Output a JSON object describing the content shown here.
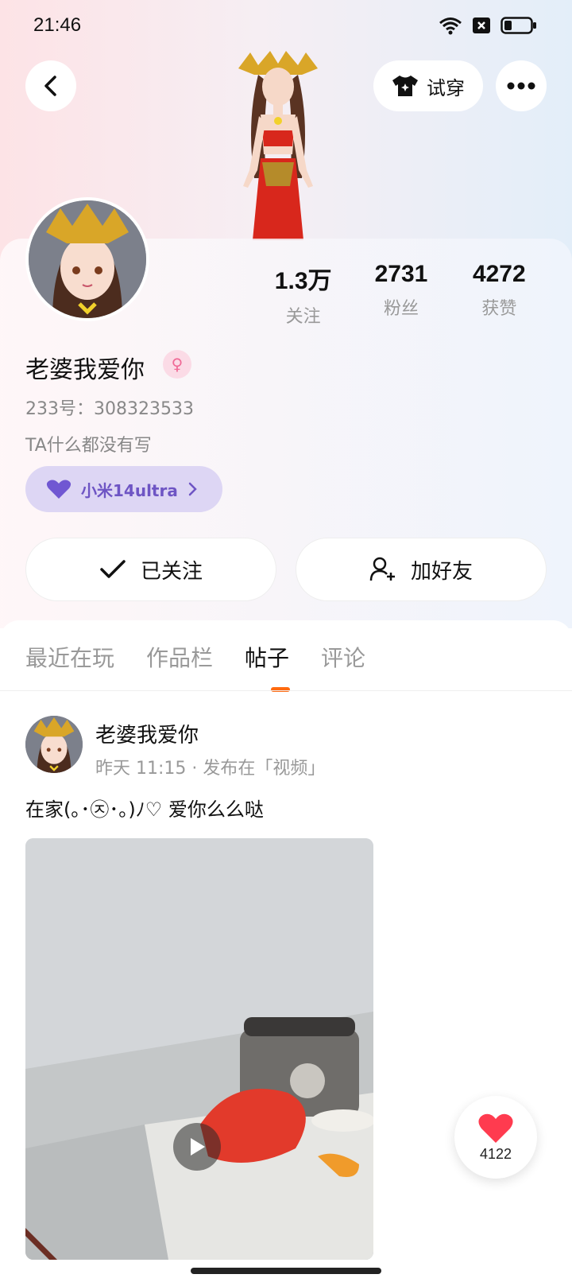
{
  "status_bar": {
    "time": "21:46"
  },
  "header": {
    "try_on_label": "试穿"
  },
  "profile": {
    "username": "老婆我爱你",
    "id_line": "233号：308323533",
    "bio": "TA什么都没有写",
    "device_tag": "小米14ultra",
    "stats": [
      {
        "value": "1.3万",
        "label": "关注"
      },
      {
        "value": "2731",
        "label": "粉丝"
      },
      {
        "value": "4272",
        "label": "获赞"
      }
    ],
    "followed_label": "已关注",
    "add_friend_label": "加好友"
  },
  "tabs": [
    {
      "label": "最近在玩"
    },
    {
      "label": "作品栏"
    },
    {
      "label": "帖子"
    },
    {
      "label": "评论"
    }
  ],
  "post": {
    "author": "老婆我爱你",
    "meta": "昨天 11:15 · 发布在「视频」",
    "text": "在家(｡･㉨･｡)ﾉ♡ 爱你么么哒"
  },
  "like_float": {
    "count": "4122"
  },
  "colors": {
    "accent": "#ff6a10",
    "device_tag_bg": "#ddd6f4",
    "device_tag_text": "#6e55c4",
    "like": "#ff3b4f"
  }
}
